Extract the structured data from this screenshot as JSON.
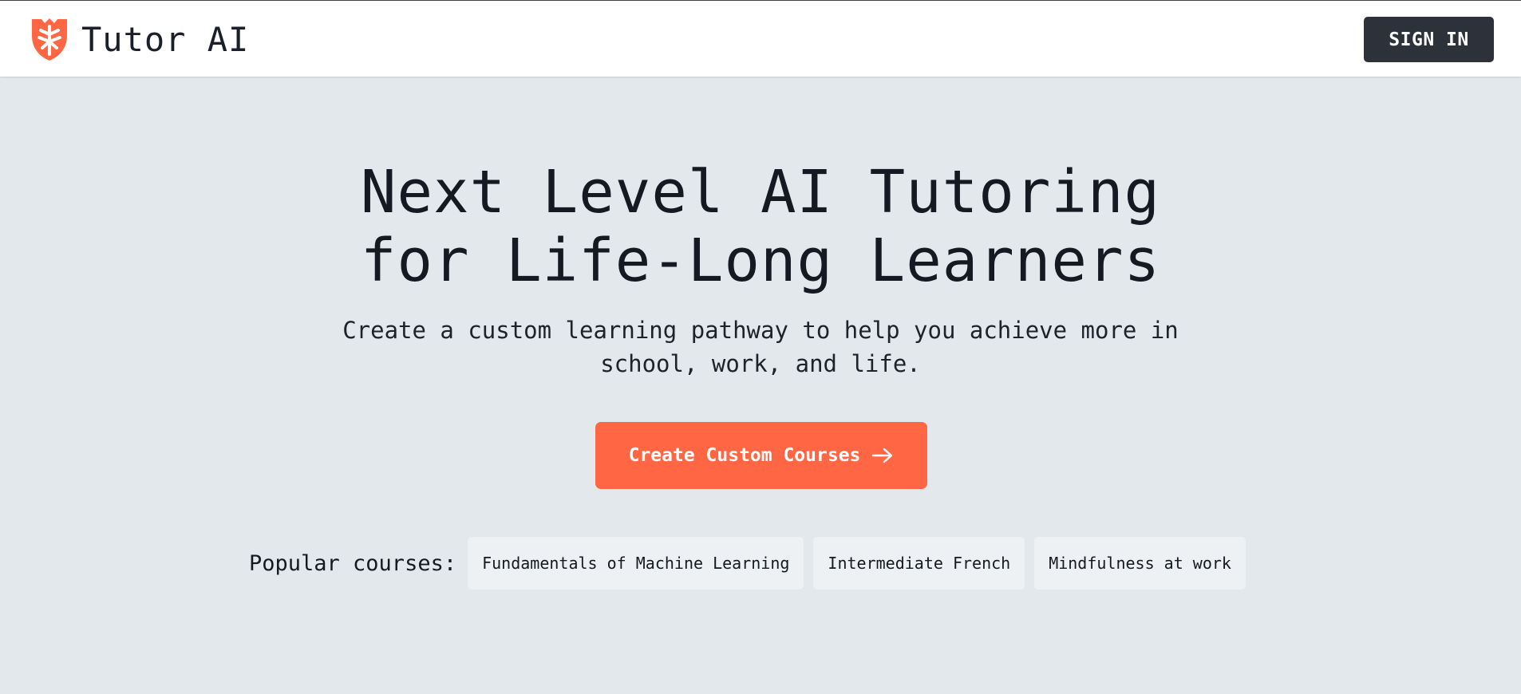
{
  "header": {
    "brand_name": "Tutor AI",
    "logo_icon": "shield-leaf-icon",
    "sign_in_label": "SIGN IN"
  },
  "hero": {
    "title_line1": "Next Level AI Tutoring",
    "title_line2": "for Life-Long Learners",
    "subtitle_line1": "Create a custom learning pathway to help you achieve more in",
    "subtitle_line2": "school, work, and life.",
    "cta_label": "Create Custom Courses",
    "cta_icon": "arrow-right-icon"
  },
  "popular": {
    "label": "Popular courses:",
    "courses": [
      "Fundamentals of Machine Learning",
      "Intermediate French",
      "Mindfulness at work"
    ]
  },
  "colors": {
    "background": "#e3e8ec",
    "header_background": "#ffffff",
    "accent": "#ff6643",
    "sign_in_button": "#2d323a",
    "chip_background": "#eef1f3",
    "text": "#141922"
  }
}
